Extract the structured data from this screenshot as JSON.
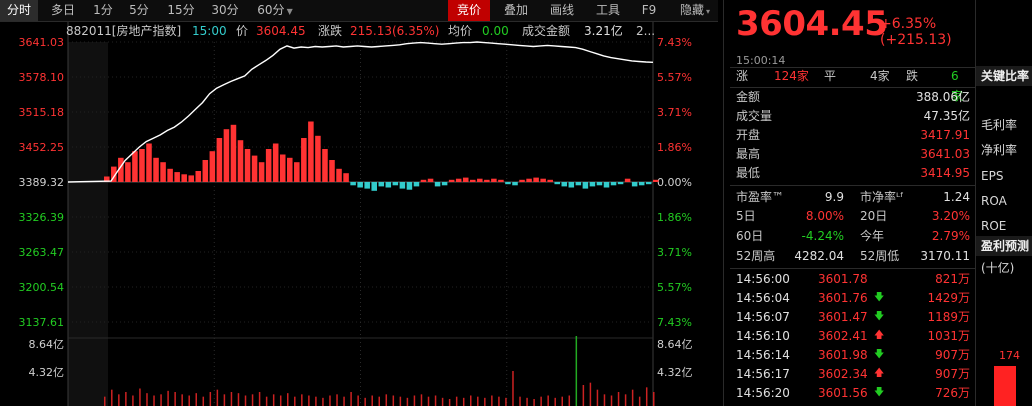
{
  "toolbar": {
    "left_items": [
      "分时",
      "多日",
      "1分",
      "5分",
      "15分",
      "30分",
      "60分"
    ],
    "right_items": [
      "竞价",
      "叠加",
      "画线",
      "工具",
      "F9",
      "隐藏"
    ]
  },
  "info": {
    "code_name": "882011[房地产指数]",
    "time": "15:00",
    "price_label": "价",
    "price": "3604.45",
    "change_label": "涨跌",
    "change": "215.13(6.35%)",
    "avg_label": "均价",
    "avg": "0.00",
    "amount_label": "成交金额",
    "amount": "3.21亿",
    "extra": "2..."
  },
  "chart_data": {
    "type": "line",
    "base": 3389.32,
    "y_left_ticks": [
      "3641.03",
      "3578.10",
      "3515.18",
      "3452.25",
      "3389.32",
      "3326.39",
      "3263.47",
      "3200.54",
      "3137.61"
    ],
    "y_right_ticks": [
      "7.43%",
      "5.57%",
      "3.71%",
      "1.86%",
      "0.00%",
      "1.86%",
      "3.71%",
      "5.57%",
      "7.43%"
    ],
    "ylim": [
      3137.61,
      3641.03
    ],
    "price_series": [
      3389.32,
      3391,
      3410,
      3428,
      3440,
      3452,
      3462,
      3468,
      3474,
      3482,
      3488,
      3497,
      3508,
      3520,
      3532,
      3548,
      3558,
      3564,
      3570,
      3575,
      3580,
      3592,
      3600,
      3608,
      3617,
      3628,
      3634,
      3630,
      3632,
      3631,
      3633,
      3632,
      3633,
      3634,
      3632,
      3633,
      3634,
      3633,
      3632,
      3633,
      3634,
      3635,
      3636,
      3638,
      3639,
      3640,
      3639,
      3638,
      3637,
      3638,
      3639,
      3640,
      3640,
      3641,
      3640,
      3639,
      3638,
      3637,
      3636,
      3635,
      3634,
      3633,
      3634,
      3635,
      3634,
      3633,
      3632,
      3631,
      3628,
      3624,
      3620,
      3616,
      3613,
      3611,
      3609,
      3607,
      3606,
      3605,
      3604.45
    ],
    "fund_bars": [
      5,
      14,
      22,
      18,
      28,
      30,
      35,
      22,
      18,
      12,
      9,
      7,
      6,
      10,
      20,
      28,
      40,
      48,
      52,
      38,
      30,
      24,
      18,
      30,
      35,
      25,
      22,
      18,
      40,
      55,
      42,
      30,
      20,
      12,
      8,
      -3,
      -5,
      -6,
      -8,
      -4,
      -5,
      -3,
      -6,
      -7,
      -4,
      2,
      3,
      -4,
      -3,
      2,
      3,
      4,
      2,
      3,
      2,
      3,
      2,
      -2,
      -3,
      2,
      3,
      4,
      3,
      2,
      -2,
      -4,
      -5,
      -3,
      -6,
      -4,
      -3,
      -5,
      -3,
      -2,
      3,
      -4,
      -3,
      -2,
      2
    ],
    "volume_bars": [
      8,
      14,
      10,
      12,
      9,
      15,
      11,
      9,
      10,
      13,
      12,
      10,
      9,
      11,
      8,
      12,
      14,
      10,
      12,
      11,
      9,
      10,
      12,
      8,
      10,
      9,
      11,
      8,
      10,
      9,
      8,
      7,
      9,
      10,
      8,
      12,
      9,
      7,
      9,
      8,
      10,
      9,
      8,
      7,
      9,
      10,
      8,
      9,
      7,
      6,
      8,
      7,
      9,
      8,
      7,
      9,
      8,
      7,
      30,
      8,
      7,
      6,
      8,
      9,
      7,
      8,
      9,
      60,
      18,
      20,
      14,
      10,
      9,
      12,
      10,
      14,
      8,
      16,
      12
    ],
    "vol_ticks": [
      "8.64亿",
      "4.32亿"
    ]
  },
  "quote": {
    "price": "3604.45",
    "change": "+6.35% (+215.13)",
    "time": "15:00:14",
    "up_label": "涨",
    "up_count": "124家",
    "flat_label": "平",
    "flat_count": "4家",
    "down_label": "跌",
    "down_count": "6家",
    "rows": [
      {
        "label": "金额",
        "value": "388.06亿",
        "color": "white"
      },
      {
        "label": "成交量",
        "value": "47.35亿",
        "color": "white"
      },
      {
        "label": "开盘",
        "value": "3417.91",
        "color": "red"
      },
      {
        "label": "最高",
        "value": "3641.03",
        "color": "red"
      },
      {
        "label": "最低",
        "value": "3414.95",
        "color": "red"
      }
    ],
    "stats": {
      "pe_label": "市盈率™",
      "pe": "9.9",
      "pb_label": "市净率ᴸᶠ",
      "pb": "1.24",
      "d5_label": "5日",
      "d5": "8.00%",
      "d20_label": "20日",
      "d20": "3.20%",
      "d60_label": "60日",
      "d60": "-4.24%",
      "ytd_label": "今年",
      "ytd": "2.79%",
      "w52h_label": "52周高",
      "w52h": "4282.04",
      "w52l_label": "52周低",
      "w52l": "3170.11"
    },
    "ticks": [
      {
        "time": "14:56:00",
        "price": "3601.78",
        "arrow": "",
        "vol": "821万"
      },
      {
        "time": "14:56:04",
        "price": "3601.76",
        "arrow": "down",
        "vol": "1429万"
      },
      {
        "time": "14:56:07",
        "price": "3601.47",
        "arrow": "down",
        "vol": "1189万"
      },
      {
        "time": "14:56:10",
        "price": "3602.41",
        "arrow": "up",
        "vol": "1031万"
      },
      {
        "time": "14:56:14",
        "price": "3601.98",
        "arrow": "down",
        "vol": "907万"
      },
      {
        "time": "14:56:17",
        "price": "3602.34",
        "arrow": "up",
        "vol": "907万"
      },
      {
        "time": "14:56:20",
        "price": "3601.56",
        "arrow": "down",
        "vol": "726万"
      }
    ]
  },
  "sidebar": {
    "header1": "关键比率",
    "items": [
      "毛利率",
      "净利率",
      "EPS",
      "ROA",
      "ROE"
    ],
    "header2": "盈利预测",
    "sub": "(十亿)",
    "bar_value": "174"
  },
  "colors": {
    "up": "#ff3333",
    "down": "#22cc22",
    "line": "#ffffff",
    "fund_down": "#33cccc",
    "volume": "#cc2222",
    "volume_hi": "#22aa22"
  }
}
